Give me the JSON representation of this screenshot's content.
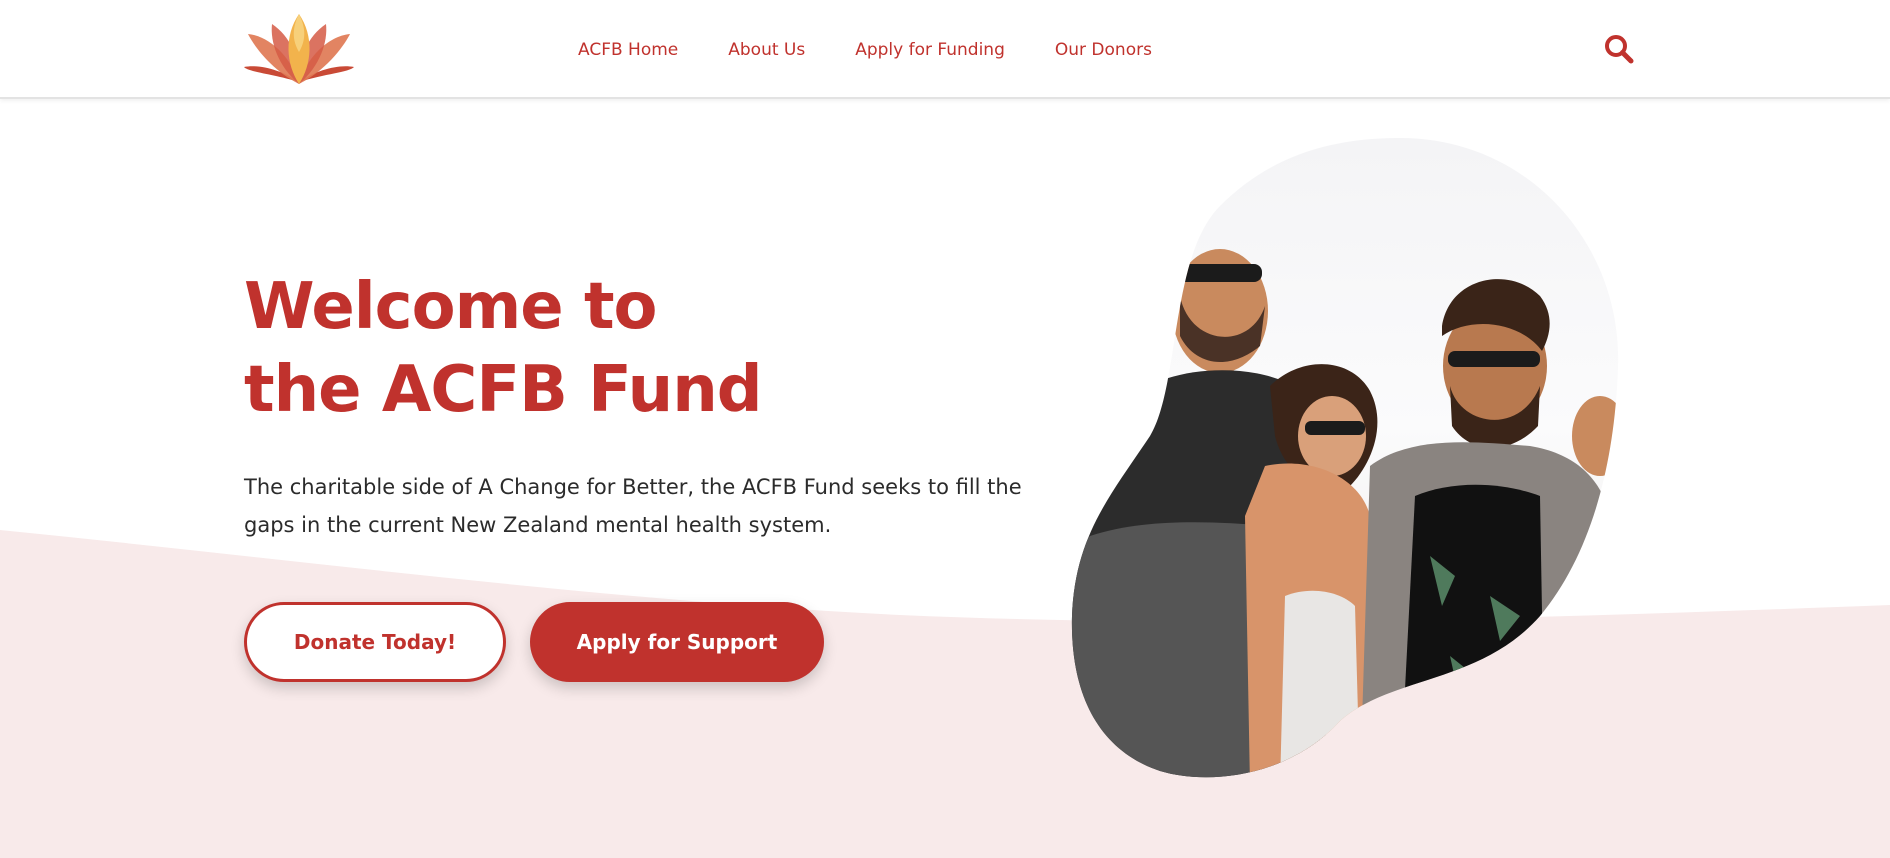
{
  "nav": {
    "items": [
      {
        "label": "ACFB Home"
      },
      {
        "label": "About Us"
      },
      {
        "label": "Apply for Funding"
      },
      {
        "label": "Our Donors"
      }
    ]
  },
  "hero": {
    "title_line1": "Welcome to",
    "title_line2": "the ACFB Fund",
    "description": "The charitable side of A Change for Better, the ACFB Fund seeks to fill the gaps in the current New Zealand mental health system.",
    "donate_label": "Donate Today!",
    "apply_label": "Apply for Support"
  },
  "icons": {
    "logo": "lotus-logo-icon",
    "search": "search-icon"
  },
  "colors": {
    "brand": "#c0322d",
    "wave": "#f8eaea",
    "text": "#2b2b2b"
  }
}
